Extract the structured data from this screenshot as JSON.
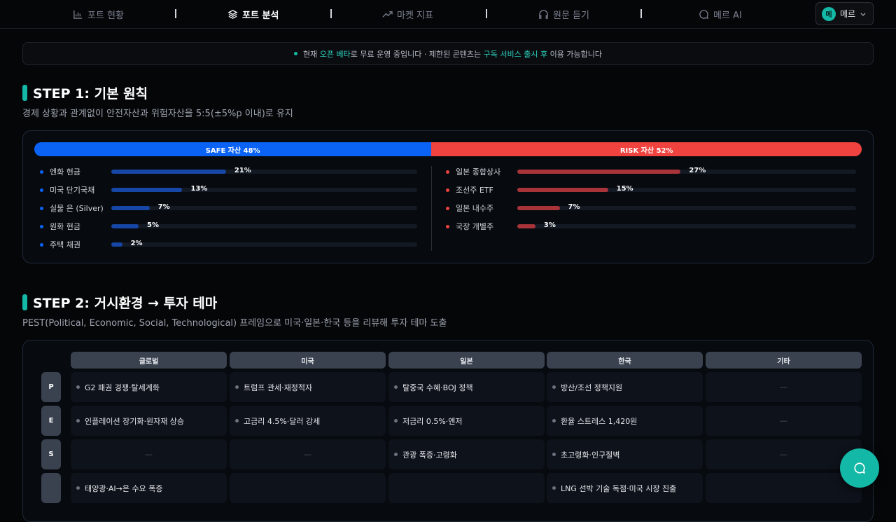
{
  "nav": {
    "items": [
      {
        "label": "포트 현황",
        "icon": "bar-chart-icon"
      },
      {
        "label": "포트 분석",
        "icon": "layers-icon"
      },
      {
        "label": "마켓 지표",
        "icon": "trending-icon"
      },
      {
        "label": "원문 듣기",
        "icon": "headphones-icon"
      },
      {
        "label": "메르 AI",
        "icon": "chat-icon"
      }
    ],
    "user_avatar": "메",
    "user_name": "메르"
  },
  "banner": {
    "p1": "현재 ",
    "beta": "오픈 베타",
    "p2": "로 무료 운영 중입니다 · 제한된 콘텐츠는 ",
    "sub": "구독 서비스 출시 후",
    "p3": " 이용 가능합니다"
  },
  "step1": {
    "title": "STEP 1: 기본 원칙",
    "subtitle": "경제 상황과 관계없이 안전자산과 위험자산을 5:5(±5%p 이내)로 유지",
    "safe_label": "SAFE 자산 48%",
    "risk_label": "RISK 자산 52%",
    "safe_share": 48,
    "colors": {
      "safe": "#0b63f6",
      "risk": "#f0433f",
      "safe_fill": "#1747a6",
      "risk_fill": "#a8343a"
    },
    "safe": [
      {
        "name": "엔화 현금",
        "pct": "21%",
        "value": 21
      },
      {
        "name": "미국 단기국채",
        "pct": "13%",
        "value": 13
      },
      {
        "name": "실물 은 (Silver)",
        "pct": "7%",
        "value": 7
      },
      {
        "name": "원화 현금",
        "pct": "5%",
        "value": 5
      },
      {
        "name": "주택 채권",
        "pct": "2%",
        "value": 2
      }
    ],
    "risk": [
      {
        "name": "일본 종합상사",
        "pct": "27%",
        "value": 27
      },
      {
        "name": "조선주 ETF",
        "pct": "15%",
        "value": 15
      },
      {
        "name": "일본 내수주",
        "pct": "7%",
        "value": 7
      },
      {
        "name": "국장 개별주",
        "pct": "3%",
        "value": 3
      }
    ]
  },
  "step2": {
    "title": "STEP 2: 거시환경 → 투자 테마",
    "subtitle": "PEST(Political, Economic, Social, Technological) 프레임으로 미국·일본·한국 등을 리뷰해 투자 테마 도출",
    "columns": [
      "글로벌",
      "미국",
      "일본",
      "한국",
      "기타"
    ],
    "rows": [
      {
        "label": "P",
        "cells": [
          "G2 패권 경쟁·탈세계화",
          "트럼프 관세·재정적자",
          "탈중국 수혜·BOJ 정책",
          "방산/조선 정책지원",
          "—"
        ]
      },
      {
        "label": "E",
        "cells": [
          "인플레이션 장기화·원자재 상승",
          "고금리 4.5%·달러 강세",
          "저금리 0.5%·엔저",
          "환율 스트레스 1,420원",
          "—"
        ]
      },
      {
        "label": "S",
        "cells": [
          "—",
          "—",
          "관광 폭증·고령화",
          "초고령화·인구절벽",
          "—"
        ]
      },
      {
        "label": "",
        "cells": [
          "태양광·AI→은 수요 폭증",
          "",
          "",
          "LNG 선박 기술 독점·미국 시장 진출",
          ""
        ]
      }
    ]
  },
  "fab": {
    "icon": "chat-bubble-icon"
  }
}
